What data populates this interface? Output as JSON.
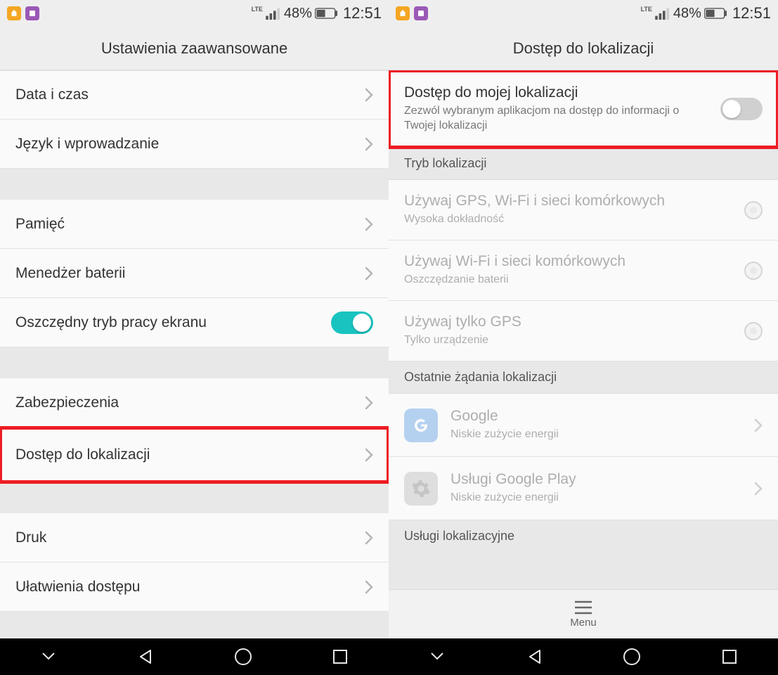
{
  "status": {
    "lte": "LTE",
    "battery_pct": "48%",
    "time": "12:51"
  },
  "left": {
    "title": "Ustawienia zaawansowane",
    "rows": {
      "date_time": "Data i czas",
      "lang_input": "Język i wprowadzanie",
      "memory": "Pamięć",
      "battery_mgr": "Menedżer baterii",
      "screen_saving": "Oszczędny tryb pracy ekranu",
      "security": "Zabezpieczenia",
      "location": "Dostęp do lokalizacji",
      "print": "Druk",
      "accessibility": "Ułatwienia dostępu"
    }
  },
  "right": {
    "title": "Dostęp do lokalizacji",
    "access": {
      "title": "Dostęp do mojej lokalizacji",
      "sub": "Zezwól wybranym aplikacjom na dostęp do informacji o Twojej lokalizacji"
    },
    "section_mode": "Tryb lokalizacji",
    "modes": {
      "gps_wifi_cell_title": "Używaj GPS, Wi-Fi i sieci komórkowych",
      "gps_wifi_cell_sub": "Wysoka dokładność",
      "wifi_cell_title": "Używaj Wi-Fi i sieci komórkowych",
      "wifi_cell_sub": "Oszczędzanie baterii",
      "gps_title": "Używaj tylko GPS",
      "gps_sub": "Tylko urządzenie"
    },
    "section_recent": "Ostatnie żądania lokalizacji",
    "apps": {
      "google_title": "Google",
      "google_sub": "Niskie zużycie energii",
      "play_title": "Usługi Google Play",
      "play_sub": "Niskie zużycie energii"
    },
    "section_services": "Usługi lokalizacyjne",
    "menu_label": "Menu"
  }
}
